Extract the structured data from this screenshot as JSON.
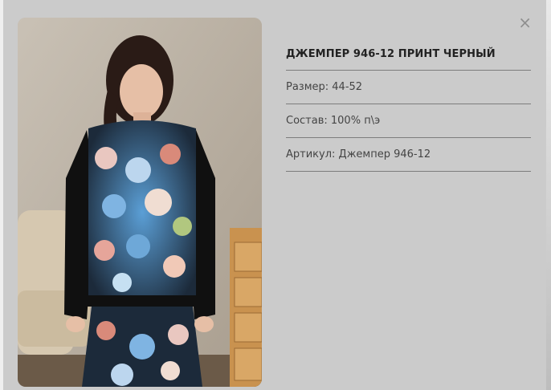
{
  "product": {
    "title": "ДЖЕМПЕР 946-12 ПРИНТ ЧЕРНЫЙ",
    "size": "Размер: 44-52",
    "composition": "Состав: 100% п\\э",
    "article": "Артикул: Джемпер 946-12"
  },
  "modal": {
    "close_label": "×"
  },
  "image": {
    "subject": "model in black jumper with floral print"
  },
  "colors": {
    "modal_bg": "#cbcbcb",
    "divider": "#7d7d7d",
    "title_text": "#222222"
  }
}
